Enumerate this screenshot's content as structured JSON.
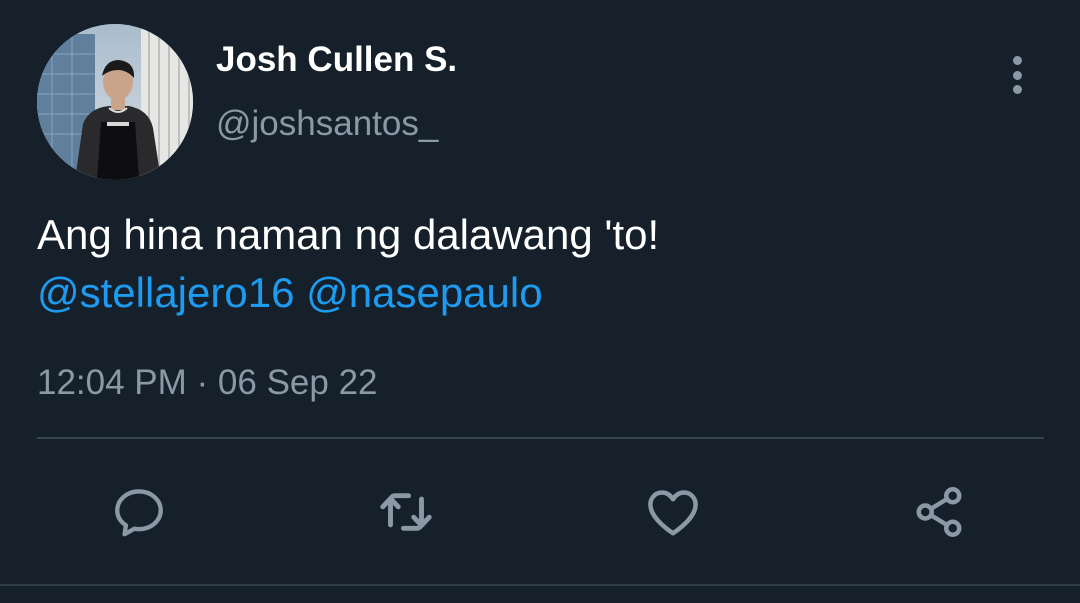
{
  "author": {
    "display_name": "Josh Cullen S.",
    "handle": "@joshsantos_"
  },
  "tweet": {
    "text_plain": "Ang hina naman ng dalawang 'to!",
    "mentions": [
      "@stellajero16",
      "@nasepaulo"
    ],
    "timestamp": "12:04 PM · 06 Sep 22"
  },
  "actions": {
    "reply_icon": "reply-icon",
    "retweet_icon": "retweet-icon",
    "like_icon": "heart-icon",
    "share_icon": "share-icon"
  },
  "colors": {
    "background": "#15202b",
    "text_primary": "#ffffff",
    "text_secondary": "#8b98a5",
    "link": "#1d9bf0",
    "divider": "#38444d"
  }
}
